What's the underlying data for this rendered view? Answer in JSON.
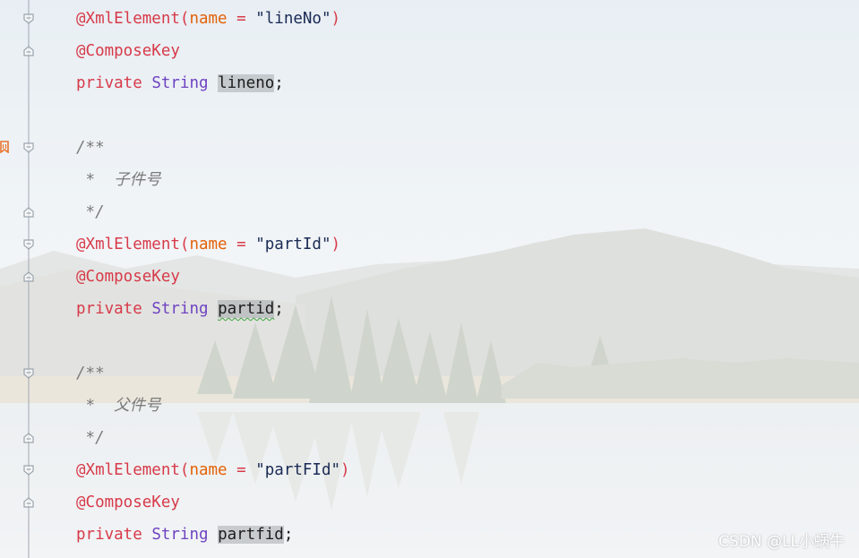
{
  "editor": {
    "lines": [
      {
        "tokens": [
          {
            "t": "@XmlElement",
            "c": "ann"
          },
          {
            "t": "(",
            "c": "paren"
          },
          {
            "t": "name",
            "c": "param"
          },
          {
            "t": " = ",
            "c": "eq"
          },
          {
            "t": "\"lineNo\"",
            "c": "str"
          },
          {
            "t": ")",
            "c": "paren"
          }
        ]
      },
      {
        "tokens": [
          {
            "t": "@ComposeKey",
            "c": "ann"
          }
        ]
      },
      {
        "tokens": [
          {
            "t": "private",
            "c": "kw"
          },
          {
            "t": " "
          },
          {
            "t": "String",
            "c": "type"
          },
          {
            "t": " "
          },
          {
            "t": "lineno",
            "c": "ident hl"
          },
          {
            "t": ";",
            "c": "punct"
          }
        ]
      },
      {
        "tokens": []
      },
      {
        "tokens": [
          {
            "t": "/**",
            "c": "comment"
          }
        ]
      },
      {
        "tokens": [
          {
            "t": " *  子件号",
            "c": "comment"
          }
        ]
      },
      {
        "tokens": [
          {
            "t": " */",
            "c": "comment"
          }
        ]
      },
      {
        "tokens": [
          {
            "t": "@XmlElement",
            "c": "ann"
          },
          {
            "t": "(",
            "c": "paren"
          },
          {
            "t": "name",
            "c": "param"
          },
          {
            "t": " = ",
            "c": "eq"
          },
          {
            "t": "\"partId\"",
            "c": "str"
          },
          {
            "t": ")",
            "c": "paren"
          }
        ]
      },
      {
        "tokens": [
          {
            "t": "@ComposeKey",
            "c": "ann"
          }
        ]
      },
      {
        "tokens": [
          {
            "t": "private",
            "c": "kw"
          },
          {
            "t": " "
          },
          {
            "t": "String",
            "c": "type"
          },
          {
            "t": " "
          },
          {
            "t": "partid",
            "c": "ident hl squig"
          },
          {
            "t": ";",
            "c": "punct"
          }
        ]
      },
      {
        "tokens": []
      },
      {
        "tokens": [
          {
            "t": "/**",
            "c": "comment"
          }
        ]
      },
      {
        "tokens": [
          {
            "t": " *  父件号",
            "c": "comment"
          }
        ]
      },
      {
        "tokens": [
          {
            "t": " */",
            "c": "comment"
          }
        ]
      },
      {
        "tokens": [
          {
            "t": "@XmlElement",
            "c": "ann"
          },
          {
            "t": "(",
            "c": "paren"
          },
          {
            "t": "name",
            "c": "param"
          },
          {
            "t": " = ",
            "c": "eq"
          },
          {
            "t": "\"partFId\"",
            "c": "str"
          },
          {
            "t": ")",
            "c": "paren"
          }
        ]
      },
      {
        "tokens": [
          {
            "t": "@ComposeKey",
            "c": "ann"
          }
        ]
      },
      {
        "tokens": [
          {
            "t": "private",
            "c": "kw"
          },
          {
            "t": " "
          },
          {
            "t": "String",
            "c": "type"
          },
          {
            "t": " "
          },
          {
            "t": "partfid",
            "c": "ident hl"
          },
          {
            "t": ";",
            "c": "punct"
          }
        ]
      }
    ],
    "fold_markers": [
      {
        "line": 0,
        "kind": "open"
      },
      {
        "line": 1,
        "kind": "close"
      },
      {
        "line": 4,
        "kind": "open"
      },
      {
        "line": 6,
        "kind": "close"
      },
      {
        "line": 7,
        "kind": "open"
      },
      {
        "line": 8,
        "kind": "close"
      },
      {
        "line": 11,
        "kind": "open"
      },
      {
        "line": 13,
        "kind": "close"
      },
      {
        "line": 14,
        "kind": "open"
      },
      {
        "line": 15,
        "kind": "close"
      }
    ]
  },
  "watermark": "CSDN @LL小蜗牛",
  "colors": {
    "annotation": "#d73a49",
    "param": "#e36209",
    "string": "#1a2a55",
    "keyword": "#d73a49",
    "type": "#6f42c1",
    "comment": "#7a7a7a",
    "gutter_line": "#96a0aa",
    "bookmark": "#e8742c"
  }
}
